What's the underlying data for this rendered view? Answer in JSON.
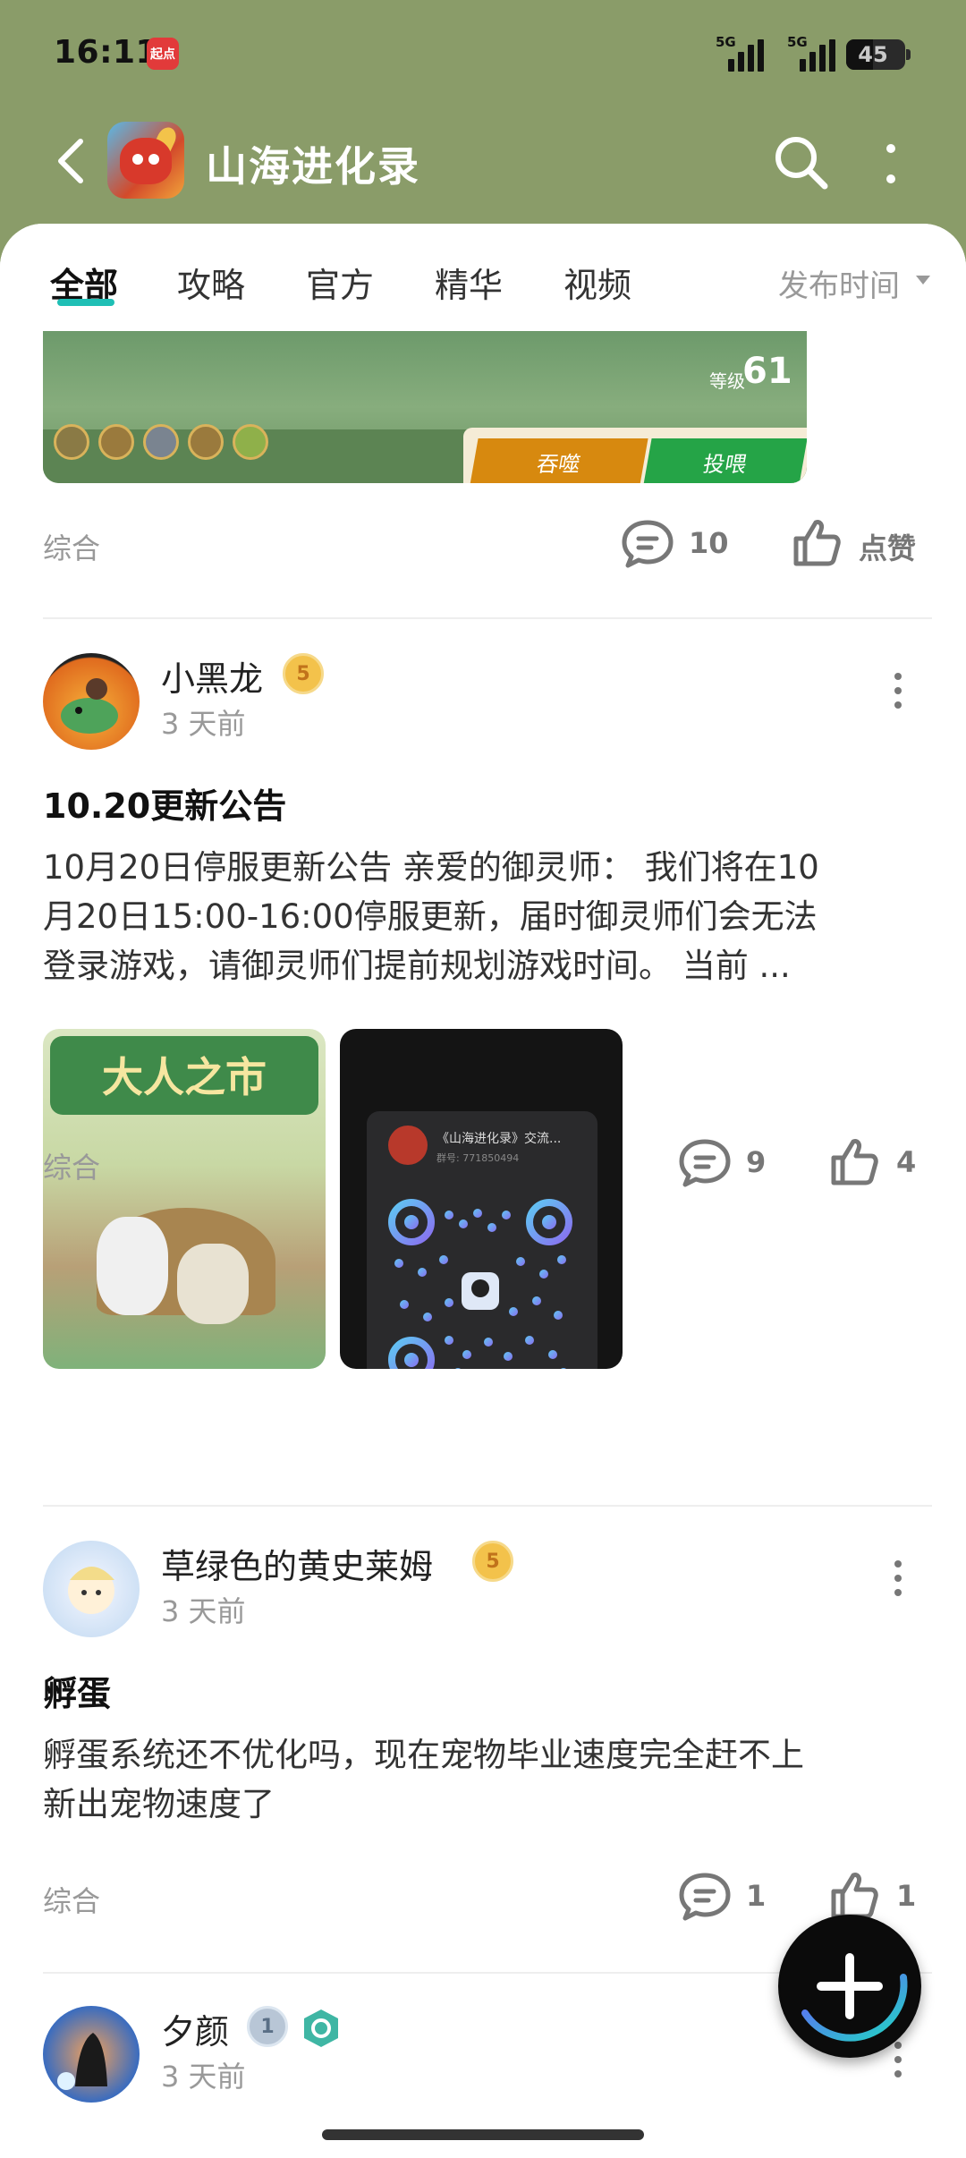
{
  "status_bar": {
    "time": "16:11",
    "app_badge": "起点",
    "battery": "45",
    "network": "5G"
  },
  "header": {
    "title": "山海进化录"
  },
  "tabs": [
    {
      "label": "全部"
    },
    {
      "label": "攻略"
    },
    {
      "label": "官方"
    },
    {
      "label": "精华"
    },
    {
      "label": "视频"
    }
  ],
  "sort": {
    "label": "发布时间"
  },
  "banner": {
    "level_label": "等级",
    "level": "61",
    "devour_label": "吞噬",
    "feed_label": "投喂"
  },
  "posts": [
    {
      "category": "综合",
      "comments": "10",
      "likes": "点赞"
    },
    {
      "author": "小黑龙",
      "badge": "5",
      "time": "3 天前",
      "title": "10.20更新公告",
      "body_lines": [
        "10月20日停服更新公告 亲爱的御灵师： 我们将在10",
        "月20日15:00-16:00停服更新，届时御灵师们会无法",
        "登录游戏，请御灵师们提前规划游戏时间。 当前 ..."
      ],
      "image1_text": "大人之市",
      "image2_group": "《山海进化录》交流...",
      "image2_group_id": "群号: 771850494",
      "category": "综合",
      "comments": "9",
      "likes": "4"
    },
    {
      "author": "草绿色的黄史莱姆",
      "badge": "5",
      "time": "3 天前",
      "title": "孵蛋",
      "body_lines": [
        "孵蛋系统还不优化吗，现在宠物毕业速度完全赶不上",
        "新出宠物速度了"
      ],
      "category": "综合",
      "comments": "1",
      "likes": "1"
    },
    {
      "author": "夕颜",
      "badge": "1",
      "time": "3 天前"
    }
  ],
  "colors": {
    "accent": "#1fbfb5",
    "header_bg": "#8a9c69"
  }
}
